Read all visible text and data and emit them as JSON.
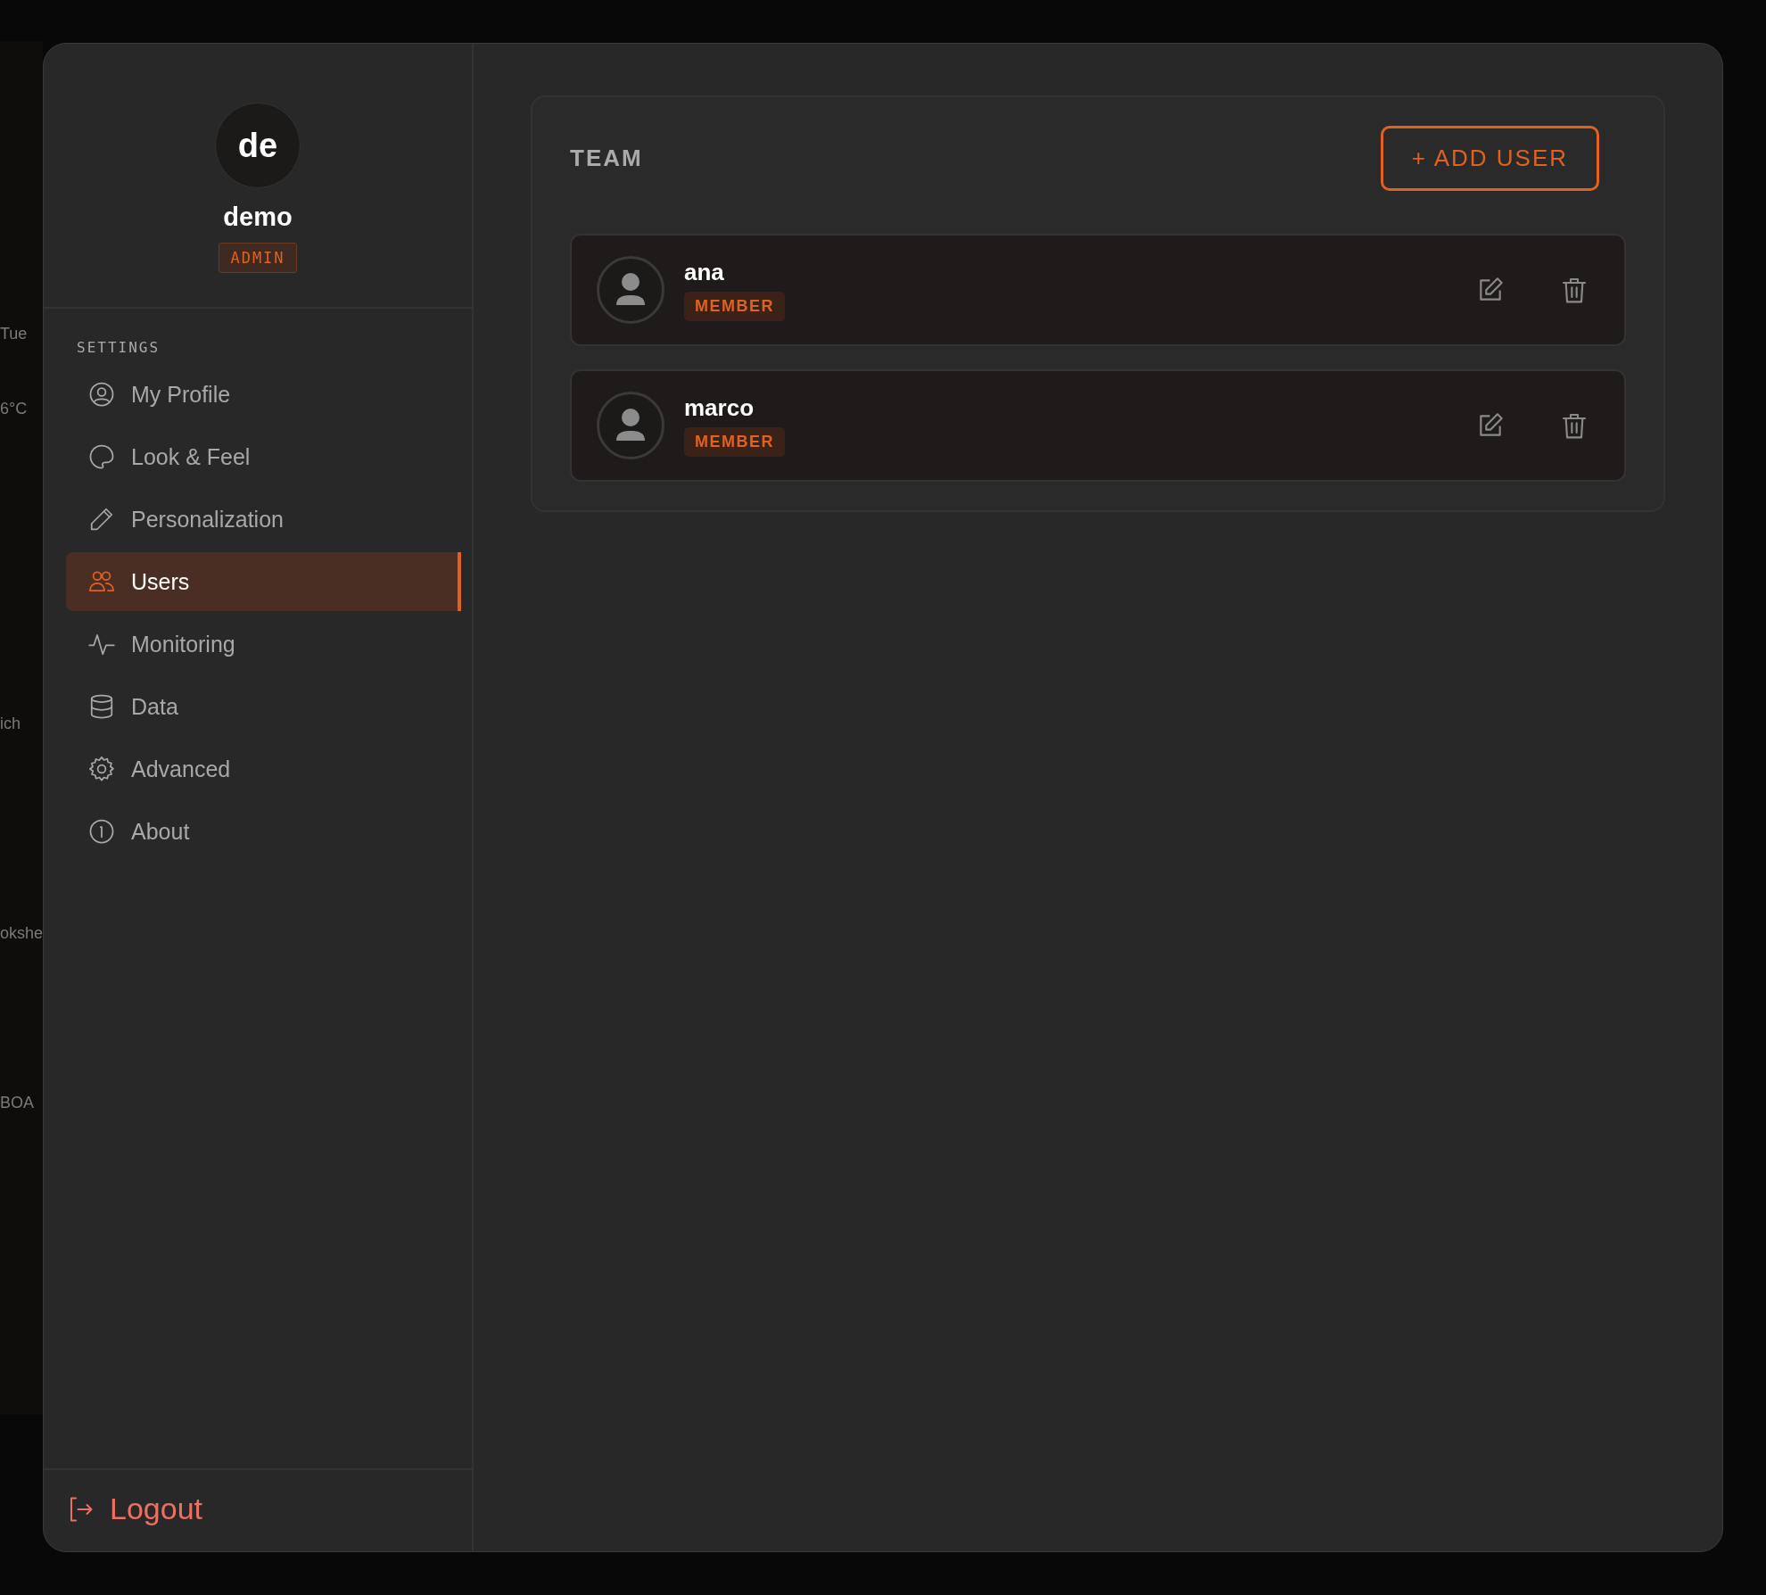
{
  "background": {
    "texts": [
      "Tue",
      "6°C",
      "ich",
      "okshe",
      "BOA"
    ]
  },
  "profile": {
    "initials": "de",
    "name": "demo",
    "role": "ADMIN"
  },
  "sidebar": {
    "heading": "SETTINGS",
    "items": [
      {
        "label": "My Profile",
        "selected": false
      },
      {
        "label": "Look & Feel",
        "selected": false
      },
      {
        "label": "Personalization",
        "selected": false
      },
      {
        "label": "Users",
        "selected": true
      },
      {
        "label": "Monitoring",
        "selected": false
      },
      {
        "label": "Data",
        "selected": false
      },
      {
        "label": "Advanced",
        "selected": false
      },
      {
        "label": "About",
        "selected": false
      }
    ],
    "logout": "Logout"
  },
  "team": {
    "title": "TEAM",
    "add_button": "+ ADD USER",
    "users": [
      {
        "name": "ana",
        "role": "MEMBER"
      },
      {
        "name": "marco",
        "role": "MEMBER"
      }
    ]
  }
}
